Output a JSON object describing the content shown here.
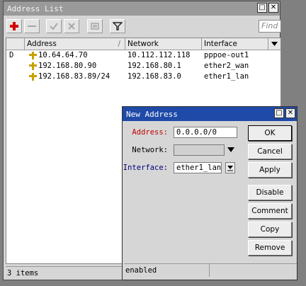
{
  "main_window": {
    "title": "Address List",
    "title_buttons": {
      "restore": "□",
      "close": "✕"
    },
    "toolbar": {
      "add_icon": "plus-icon",
      "remove_icon": "minus-icon",
      "enable_icon": "check-icon",
      "disable_icon": "x-icon",
      "comment_icon": "note-icon",
      "filter_icon": "filter-icon",
      "find_placeholder": "Find"
    },
    "table": {
      "columns": [
        "Address",
        "Network",
        "Interface"
      ],
      "rows": [
        {
          "flag": "D",
          "address": "10.64.64.70",
          "network": "10.112.112.118",
          "interface": "pppoe-out1"
        },
        {
          "flag": "",
          "address": "192.168.80.90",
          "network": "192.168.80.1",
          "interface": "ether2_wan"
        },
        {
          "flag": "",
          "address": "192.168.83.89/24",
          "network": "192.168.83.0",
          "interface": "ether1_lan"
        }
      ]
    },
    "status": "3 items"
  },
  "dialog": {
    "title": "New Address",
    "title_buttons": {
      "restore": "□",
      "close": "✕"
    },
    "fields": {
      "address_label": "Address:",
      "address_value": "0.0.0.0/0",
      "network_label": "Network:",
      "network_value": "",
      "interface_label": "Interface:",
      "interface_value": "ether1_lan"
    },
    "buttons": {
      "ok": "OK",
      "cancel": "Cancel",
      "apply": "Apply",
      "disable": "Disable",
      "comment": "Comment",
      "copy": "Copy",
      "remove": "Remove"
    },
    "status": "enabled"
  },
  "colors": {
    "dialog_titlebar": "#1f4aa8",
    "main_titlebar": "#9a9a9a",
    "required_label": "#c00000",
    "interface_label": "#00007a",
    "add_icon": "#d40000",
    "address_icon": "#c8a000"
  }
}
